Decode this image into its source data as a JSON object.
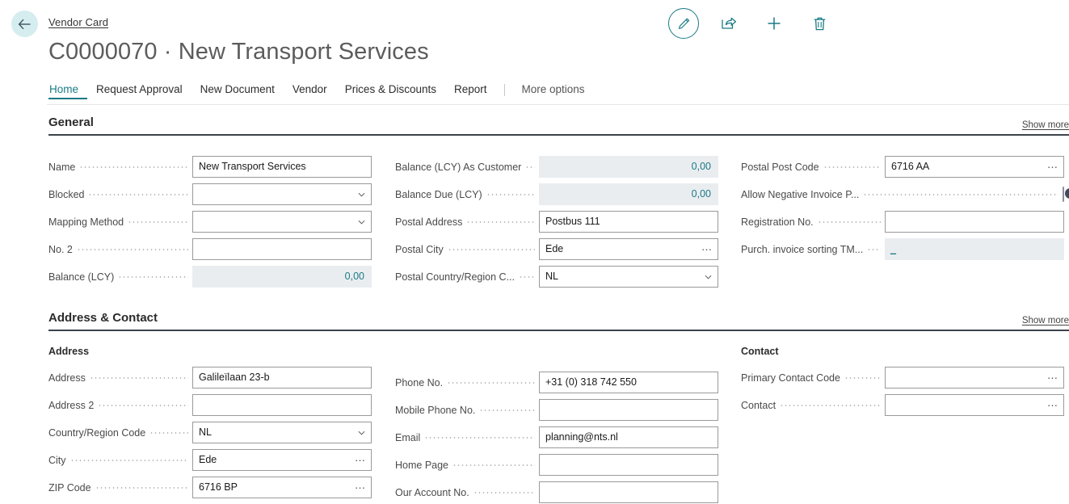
{
  "header": {
    "back_icon": "back-arrow-icon",
    "breadcrumb": "Vendor Card",
    "title": "C0000070 · New Transport Services",
    "toolbar": [
      {
        "name": "edit-button",
        "icon": "pencil-icon",
        "label": "Edit"
      },
      {
        "name": "share-button",
        "icon": "share-icon",
        "label": "Share"
      },
      {
        "name": "new-button",
        "icon": "plus-icon",
        "label": "New"
      },
      {
        "name": "delete-button",
        "icon": "trash-icon",
        "label": "Delete"
      }
    ]
  },
  "tabs": {
    "items": [
      {
        "label": "Home",
        "active": true
      },
      {
        "label": "Request Approval",
        "active": false
      },
      {
        "label": "New Document",
        "active": false
      },
      {
        "label": "Vendor",
        "active": false
      },
      {
        "label": "Prices & Discounts",
        "active": false
      },
      {
        "label": "Report",
        "active": false
      }
    ],
    "more_options": "More options"
  },
  "common": {
    "show_more": "Show more"
  },
  "general": {
    "title": "General",
    "col1": [
      {
        "label": "Name",
        "value": "New Transport Services",
        "type": "text"
      },
      {
        "label": "Blocked",
        "value": "",
        "type": "dropdown"
      },
      {
        "label": "Mapping Method",
        "value": "",
        "type": "dropdown"
      },
      {
        "label": "No. 2",
        "value": "",
        "type": "text"
      },
      {
        "label": "Balance (LCY)",
        "value": "0,00",
        "type": "readonly"
      }
    ],
    "col2": [
      {
        "label": "Balance (LCY) As Customer",
        "value": "0,00",
        "type": "readonly"
      },
      {
        "label": "Balance Due (LCY)",
        "value": "0,00",
        "type": "readonly"
      },
      {
        "label": "Postal Address",
        "value": "Postbus 111",
        "type": "text"
      },
      {
        "label": "Postal City",
        "value": "Ede",
        "type": "lookup"
      },
      {
        "label": "Postal Country/Region C...",
        "value": "NL",
        "type": "dropdown"
      }
    ],
    "col3": [
      {
        "label": "Postal Post Code",
        "value": "6716 AA",
        "type": "lookup"
      },
      {
        "label": "Allow Negative Invoice P...",
        "value": "",
        "type": "toggle",
        "checked": false
      },
      {
        "label": "Registration No.",
        "value": "",
        "type": "text"
      },
      {
        "label": "Purch. invoice sorting TM...",
        "value": "_",
        "type": "drilldown"
      }
    ]
  },
  "address_contact": {
    "title": "Address & Contact",
    "address_subhead": "Address",
    "contact_subhead": "Contact",
    "col1": [
      {
        "label": "Address",
        "value": "Galileïlaan 23-b",
        "type": "text"
      },
      {
        "label": "Address 2",
        "value": "",
        "type": "text"
      },
      {
        "label": "Country/Region Code",
        "value": "NL",
        "type": "dropdown"
      },
      {
        "label": "City",
        "value": "Ede",
        "type": "lookup"
      },
      {
        "label": "ZIP Code",
        "value": "6716 BP",
        "type": "lookup"
      }
    ],
    "col2": [
      {
        "label": "Phone No.",
        "value": "+31 (0) 318 742 550",
        "type": "text"
      },
      {
        "label": "Mobile Phone No.",
        "value": "",
        "type": "text"
      },
      {
        "label": "Email",
        "value": "planning@nts.nl",
        "type": "text"
      },
      {
        "label": "Home Page",
        "value": "",
        "type": "text"
      },
      {
        "label": "Our Account No.",
        "value": "",
        "type": "text"
      }
    ],
    "col3": [
      {
        "label": "Primary Contact Code",
        "value": "",
        "type": "lookup"
      },
      {
        "label": "Contact",
        "value": "",
        "type": "lookup"
      }
    ]
  },
  "colors": {
    "accent": "#1a7a85",
    "back_bg": "#d6edf0",
    "readonly_bg": "#eaedf0",
    "rule": "#3b434b"
  }
}
